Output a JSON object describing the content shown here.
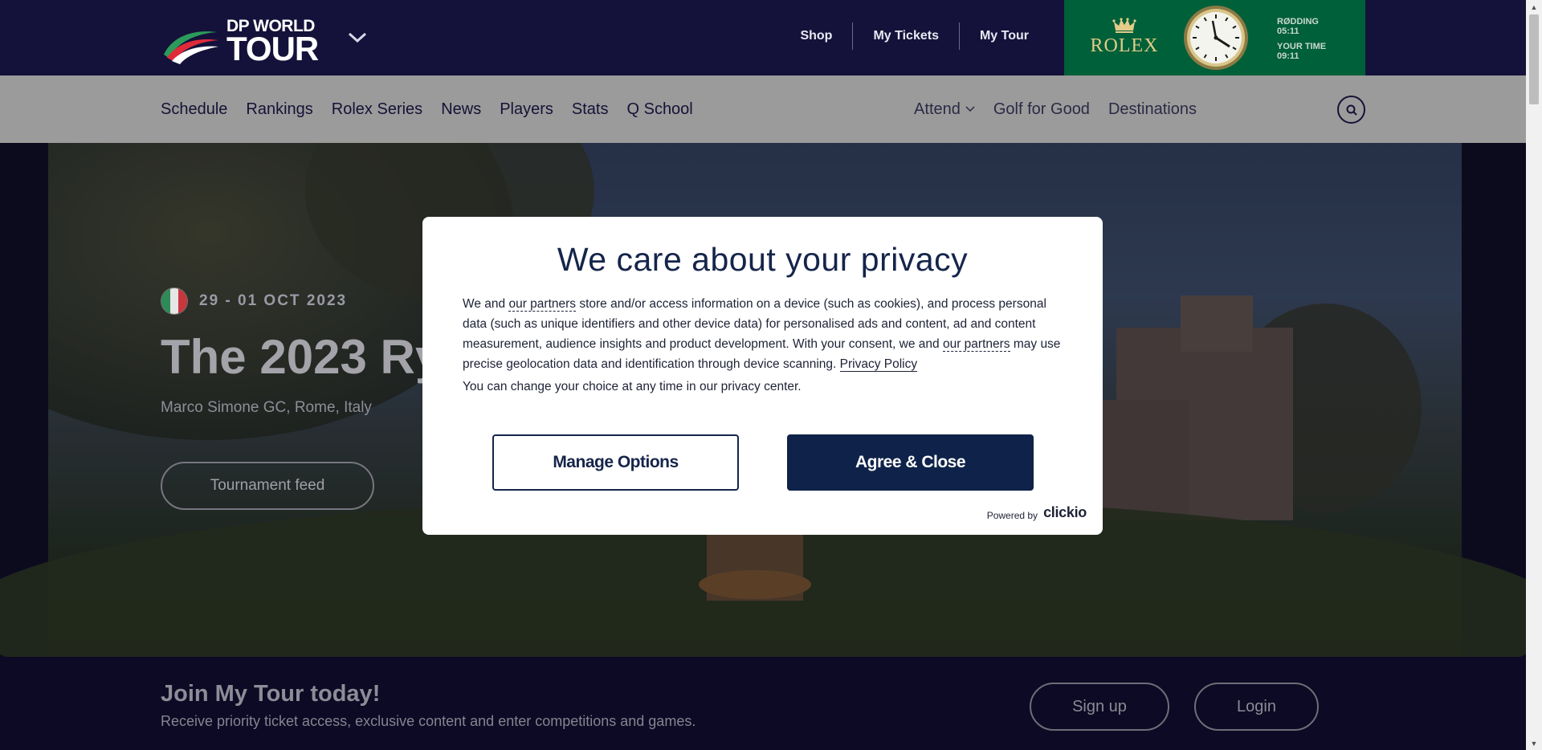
{
  "header": {
    "logo_line1": "DP WORLD",
    "logo_line2": "TOUR",
    "utility_links": [
      "Shop",
      "My Tickets",
      "My Tour"
    ],
    "sponsor": {
      "name": "ROLEX",
      "location_label": "RØDDING",
      "location_time": "05:11",
      "your_time_label": "YOUR TIME",
      "your_time": "09:11"
    }
  },
  "nav": {
    "left": [
      "Schedule",
      "Rankings",
      "Rolex Series",
      "News",
      "Players",
      "Stats",
      "Q School"
    ],
    "attend": "Attend",
    "golf_for_good": "Golf for Good",
    "destinations": "Destinations"
  },
  "hero": {
    "date": "29 - 01 OCT 2023",
    "title": "The 2023 Ry",
    "venue": "Marco Simone GC, Rome, Italy",
    "feed_button": "Tournament feed"
  },
  "join": {
    "title": "Join My Tour today!",
    "subtitle": "Receive priority ticket access, exclusive content and enter competitions and games.",
    "signup": "Sign up",
    "login": "Login"
  },
  "consent": {
    "title": "We care about your privacy",
    "text_1": "We and ",
    "partners_link": "our partners",
    "text_2": " store and/or access information on a device (such as cookies), and process personal data (such as unique identifiers and other device data) for personalised ads and content, ad and content measurement, audience insights and product development. With your consent, we and ",
    "text_3": " may use precise geolocation data and identification through device scanning. ",
    "privacy_link": "Privacy Policy",
    "note": "You can change your choice at any time in our privacy center.",
    "manage_button": "Manage Options",
    "agree_button": "Agree & Close",
    "powered_by": "Powered by",
    "brand": "clickio"
  },
  "colors": {
    "header_bg": "#14123a",
    "nav_bg": "#9b9b9b",
    "rolex_green": "#006039",
    "modal_navy": "#0f2249"
  }
}
